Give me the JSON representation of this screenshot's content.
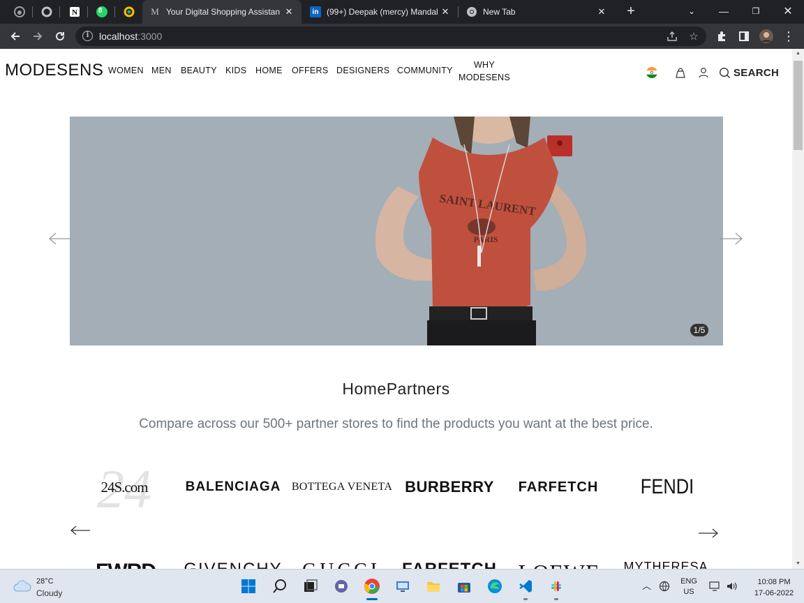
{
  "browser": {
    "tabs": [
      {
        "title": "Your Digital Shopping Assistan",
        "favicon": "M",
        "active": true
      },
      {
        "title": "(99+) Deepak (mercy) Mandal",
        "favicon": "in",
        "active": false
      },
      {
        "title": "New Tab",
        "favicon": "chrome-icon",
        "active": false
      }
    ],
    "pinned_badge": "8",
    "url_host": "localhost",
    "url_port": ":3000"
  },
  "site": {
    "logo": "MODESENS",
    "nav": [
      "WOMEN",
      "MEN",
      "BEAUTY",
      "KIDS",
      "HOME",
      "OFFERS",
      "DESIGNERS",
      "COMMUNITY"
    ],
    "nav_why_line1": "WHY",
    "nav_why_line2": "MODESENS",
    "search_label": "SEARCH",
    "hero": {
      "counter": "1/5",
      "shirt_line1": "SAINT LAURENT",
      "shirt_line2": "PARIS"
    },
    "partners": {
      "title": "HomePartners",
      "subtitle": "Compare across our 500+ partner stores to find the products you want at the best price.",
      "brands": [
        "24S.com",
        "BALENCIAGA",
        "BOTTEGA VENETA",
        "BURBERRY",
        "FARFETCH",
        "FENDI"
      ],
      "next_row": [
        "FWRD",
        "GIVENCHY",
        "GUCCI",
        "FARFETCH",
        "LOEWE",
        "MYTHERESA"
      ]
    }
  },
  "taskbar": {
    "temp": "28°C",
    "condition": "Cloudy",
    "lang_line1": "ENG",
    "lang_line2": "US",
    "time": "10:08 PM",
    "date": "17-06-2022"
  },
  "colors": {
    "hero_bg": "#a3aeb6",
    "chrome_dark": "#202124",
    "chrome_toolbar": "#35363a",
    "subtitle_gray": "#6c757d"
  }
}
